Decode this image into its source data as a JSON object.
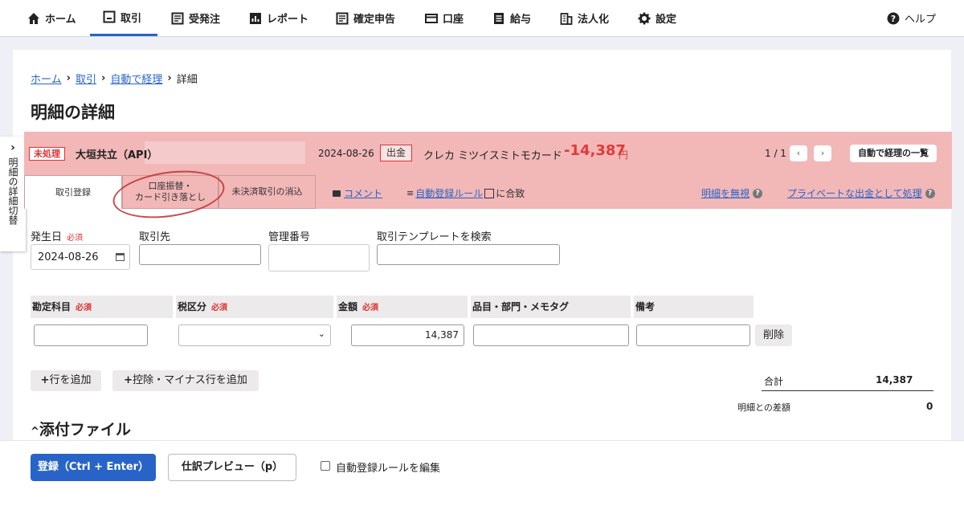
{
  "nav": {
    "home": "ホーム",
    "torihiki": "取引",
    "juhatchu": "受発注",
    "report": "レポート",
    "kakutei": "確定申告",
    "koza": "口座",
    "kyuyo": "給与",
    "hojinka": "法人化",
    "settei": "設定",
    "help": "ヘルプ"
  },
  "breadcrumb": {
    "home": "ホーム",
    "torihiki": "取引",
    "auto": "自動で経理",
    "current": "詳細"
  },
  "page_title": "明細の詳細",
  "side_toggle": "明細の詳細切替",
  "header": {
    "status": "未処理",
    "name": "大垣共立（API）",
    "date": "2024-08-26",
    "direction": "出金",
    "card": "クレカ ミツイスミトモカード",
    "amount": "-14,387",
    "currency": "円",
    "pager": "1 / 1",
    "prev": "‹",
    "next": "›",
    "list_button": "自動で経理の一覧"
  },
  "tabs": {
    "register": "取引登録",
    "transfer_line1": "口座振替・",
    "transfer_line2": "カード引き落とし",
    "clear": "未決済取引の消込"
  },
  "links": {
    "comment": "コメント",
    "auto_rule": "自動登録ルール",
    "auto_rule_suffix": "に合致",
    "ignore": "明細を無視",
    "private": "プライベートな出金として処理",
    "help_glyph": "?"
  },
  "form": {
    "date_label": "発生日",
    "required": "必須",
    "date_value": "2024-08-26",
    "partner_label": "取引先",
    "mgmt_label": "管理番号",
    "template_label": "取引テンプレートを検索"
  },
  "table": {
    "headers": [
      "勘定科目",
      "税区分",
      "金額",
      "品目・部門・メモタグ",
      "備考"
    ],
    "amount_value": "14,387",
    "delete": "削除"
  },
  "actions": {
    "add_row": "行を追加",
    "add_minus": "控除・マイナス行を追加"
  },
  "totals": {
    "total_label": "合計",
    "total_value": "14,387",
    "diff_label": "明細との差額",
    "diff_value": "0"
  },
  "attachments": {
    "title": "添付ファイル"
  },
  "footer": {
    "submit": "登録（Ctrl + Enter）",
    "preview": "仕訳プレビュー（p）",
    "edit_rule": "自動登録ルールを編集"
  },
  "colors": {
    "accent": "#2864c8",
    "pink": "#f2b7b7",
    "red": "#e03a3a"
  }
}
